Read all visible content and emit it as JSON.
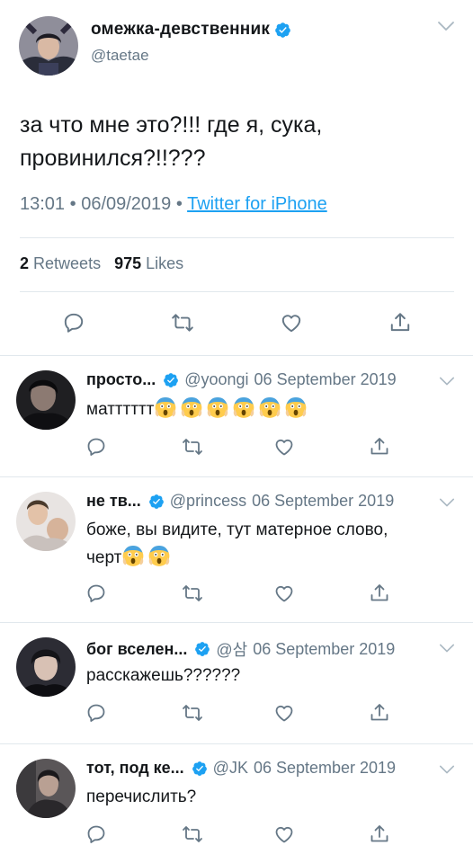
{
  "tweet": {
    "display_name": "омежка-девственник",
    "handle": "@taetae",
    "text_line1": "за что мне это?!!! где я, сука,",
    "text_line2": "провинился?!!???",
    "time": "13:01",
    "separator": "•",
    "date": "06/09/2019",
    "source": "Twitter for iPhone",
    "retweets_count": "2",
    "retweets_label": "Retweets",
    "likes_count": "975",
    "likes_label": "Likes"
  },
  "colors": {
    "accent": "#1da1f2",
    "secondary_text": "#657786",
    "divider": "#e1e8ed"
  },
  "replies": [
    {
      "name": "просто...",
      "handle": "@yoongi",
      "date": "06 September 2019",
      "text": "матттттт",
      "emoji_count": 6
    },
    {
      "name": "не тв...",
      "handle": "@princess",
      "date": "06 September 2019",
      "text_line1": "боже, вы видите, тут матерное слово,",
      "text_line2": "черт",
      "emoji_count": 2
    },
    {
      "name": "бог вселен...",
      "handle": "@삼",
      "date": "06 September 2019",
      "text": "расскажешь??????"
    },
    {
      "name": "тот, под ке...",
      "handle": "@JK",
      "date": "06 September 2019",
      "text": "перечислить?"
    }
  ],
  "icons": [
    "verified-badge-icon",
    "chevron-down-icon",
    "reply-icon",
    "retweet-icon",
    "like-icon",
    "share-icon",
    "screaming-face-emoji"
  ]
}
